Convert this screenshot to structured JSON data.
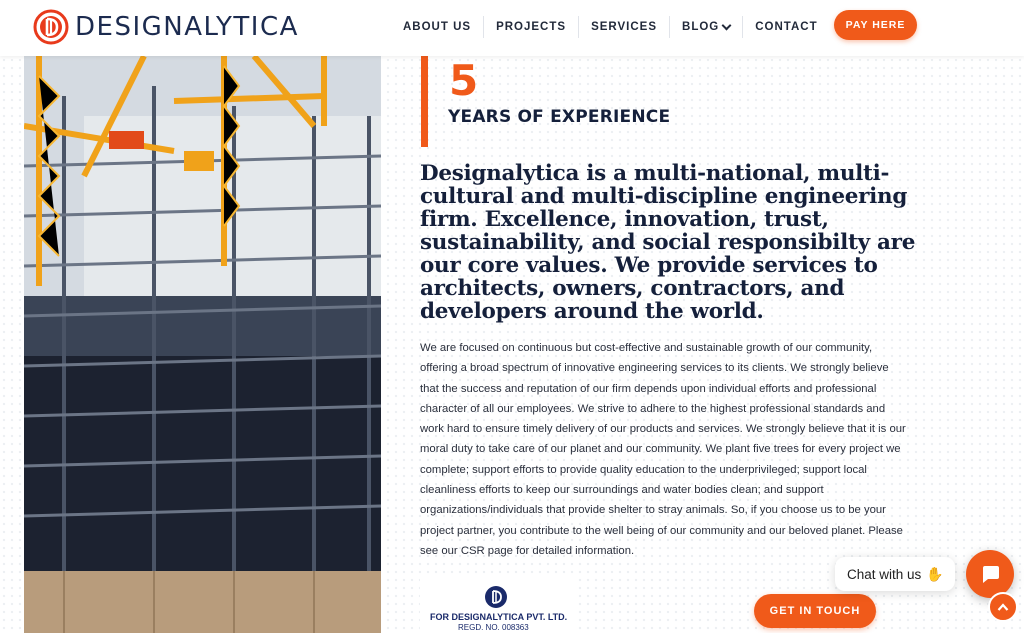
{
  "brand": {
    "name": "DESIGNALYTICA",
    "accent": "#f05a1a",
    "navy": "#15203b"
  },
  "nav": {
    "items": [
      {
        "label": "ABOUT US"
      },
      {
        "label": "PROJECTS"
      },
      {
        "label": "SERVICES"
      },
      {
        "label": "BLOG"
      },
      {
        "label": "CONTACT"
      }
    ],
    "pay_label": "PAY HERE"
  },
  "experience": {
    "number": "5",
    "label": "YEARS OF EXPERIENCE"
  },
  "headline": "Designalytica is a multi-national, multi-cultural and multi-discipline engineering firm. Excellence, innovation, trust, sustainability, and social responsibilty are our core values. We provide services to architects, owners, contractors, and developers around the world.",
  "body": "We are focused on continuous but cost-effective and sustainable growth of our community, offering a broad spectrum of innovative engineering services to its clients. We strongly believe that the success and reputation of our firm depends upon individual efforts and professional character of all our employees. We strive to adhere to the highest professional standards and work hard to ensure timely delivery of our products and services. We strongly believe that it is our moral duty to take care of our planet and our community. We plant five trees for every project we complete; support efforts to provide quality education to the underprivileged; support local cleanliness efforts to keep our surroundings and water bodies clean; and support organizations/individuals that provide shelter to stray animals. So, if you choose us to be your project partner, you contribute to the well being of our community and our beloved planet. Please see our CSR page for detailed information.",
  "registration": {
    "company": "FOR DESIGNALYTICA PVT. LTD.",
    "number": "REGD. NO. 008363"
  },
  "cta": {
    "get_in_touch": "GET IN TOUCH"
  },
  "chat": {
    "label": "Chat with us",
    "wave_icon": "waving-hand-icon",
    "button_icon": "chat-icon"
  },
  "scroll_top": {
    "icon": "chevron-up-icon"
  }
}
